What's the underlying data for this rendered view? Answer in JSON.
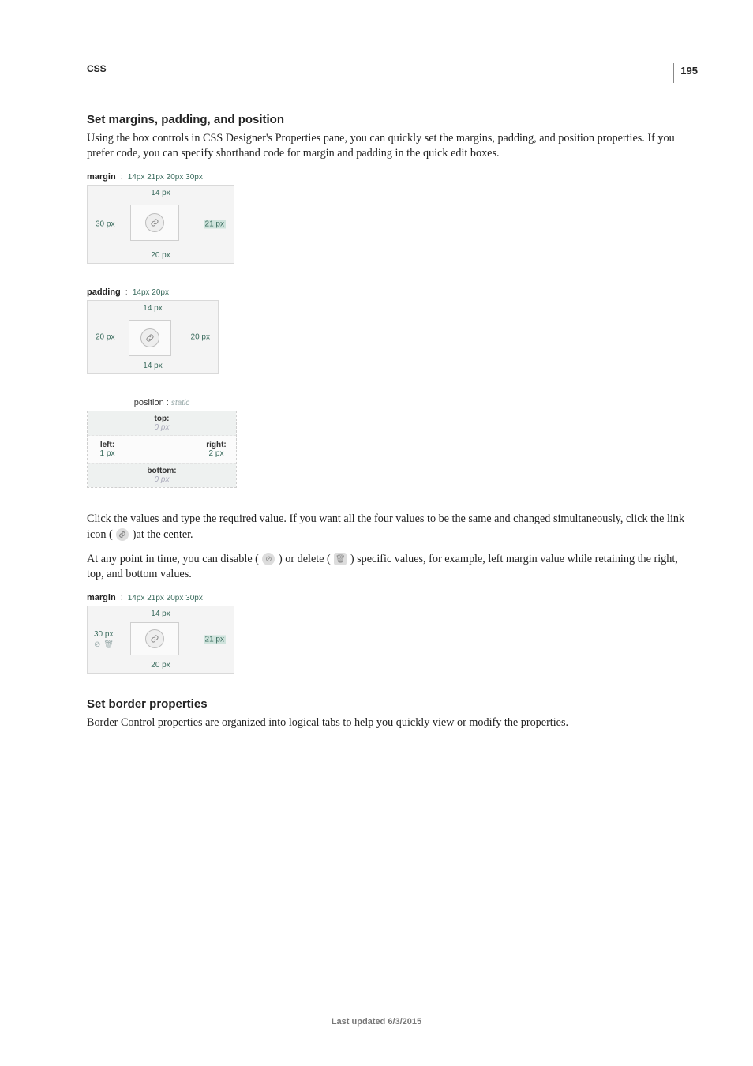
{
  "header": {
    "module_label": "CSS",
    "page_number": "195"
  },
  "section1": {
    "heading": "Set margins, padding, and position",
    "para1": "Using the box controls in CSS Designer's Properties pane, you can quickly set the margins, padding, and position properties. If you prefer code, you can specify shorthand code for margin and padding in the quick edit boxes."
  },
  "margin_widget": {
    "title": "margin",
    "shorthand": "14px 21px 20px 30px",
    "top": "14 px",
    "right": "21 px",
    "bottom": "20 px",
    "left": "30 px"
  },
  "padding_widget": {
    "title": "padding",
    "shorthand": "14px 20px",
    "top": "14 px",
    "right": "20 px",
    "bottom": "14 px",
    "left": "20 px"
  },
  "position_widget": {
    "prop_label": "position :",
    "prop_value": "static",
    "top_label": "top:",
    "top_value": "0 px",
    "left_label": "left:",
    "left_value": "1 px",
    "right_label": "right:",
    "right_value": "2 px",
    "bottom_label": "bottom:",
    "bottom_value": "0 px"
  },
  "mid": {
    "para2a": "Click the values and type the required value. If you want all the four values to be the same and changed simultaneously, click the link icon (",
    "para2b": ")at the center.",
    "para3a": "At any point in time, you can disable (",
    "para3b": ") or delete (",
    "para3c": ") specific values, for example, left margin value while retaining the right, top, and bottom values."
  },
  "margin_widget2": {
    "title": "margin",
    "shorthand": "14px 21px 20px 30px",
    "top": "14 px",
    "right": "21 px",
    "bottom": "20 px",
    "left": "30 px"
  },
  "section2": {
    "heading": "Set border properties",
    "para1": "Border Control properties are organized into logical tabs to help you quickly view or modify the properties."
  },
  "footer": {
    "text": "Last updated 6/3/2015"
  }
}
